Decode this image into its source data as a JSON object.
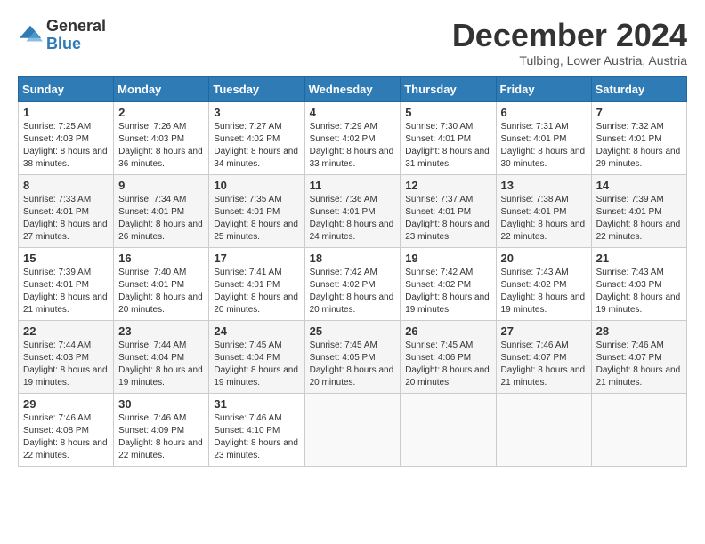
{
  "logo": {
    "general": "General",
    "blue": "Blue"
  },
  "title": "December 2024",
  "location": "Tulbing, Lower Austria, Austria",
  "weekdays": [
    "Sunday",
    "Monday",
    "Tuesday",
    "Wednesday",
    "Thursday",
    "Friday",
    "Saturday"
  ],
  "weeks": [
    [
      {
        "day": "1",
        "sunrise": "7:25 AM",
        "sunset": "4:03 PM",
        "daylight": "8 hours and 38 minutes."
      },
      {
        "day": "2",
        "sunrise": "7:26 AM",
        "sunset": "4:03 PM",
        "daylight": "8 hours and 36 minutes."
      },
      {
        "day": "3",
        "sunrise": "7:27 AM",
        "sunset": "4:02 PM",
        "daylight": "8 hours and 34 minutes."
      },
      {
        "day": "4",
        "sunrise": "7:29 AM",
        "sunset": "4:02 PM",
        "daylight": "8 hours and 33 minutes."
      },
      {
        "day": "5",
        "sunrise": "7:30 AM",
        "sunset": "4:01 PM",
        "daylight": "8 hours and 31 minutes."
      },
      {
        "day": "6",
        "sunrise": "7:31 AM",
        "sunset": "4:01 PM",
        "daylight": "8 hours and 30 minutes."
      },
      {
        "day": "7",
        "sunrise": "7:32 AM",
        "sunset": "4:01 PM",
        "daylight": "8 hours and 29 minutes."
      }
    ],
    [
      {
        "day": "8",
        "sunrise": "7:33 AM",
        "sunset": "4:01 PM",
        "daylight": "8 hours and 27 minutes."
      },
      {
        "day": "9",
        "sunrise": "7:34 AM",
        "sunset": "4:01 PM",
        "daylight": "8 hours and 26 minutes."
      },
      {
        "day": "10",
        "sunrise": "7:35 AM",
        "sunset": "4:01 PM",
        "daylight": "8 hours and 25 minutes."
      },
      {
        "day": "11",
        "sunrise": "7:36 AM",
        "sunset": "4:01 PM",
        "daylight": "8 hours and 24 minutes."
      },
      {
        "day": "12",
        "sunrise": "7:37 AM",
        "sunset": "4:01 PM",
        "daylight": "8 hours and 23 minutes."
      },
      {
        "day": "13",
        "sunrise": "7:38 AM",
        "sunset": "4:01 PM",
        "daylight": "8 hours and 22 minutes."
      },
      {
        "day": "14",
        "sunrise": "7:39 AM",
        "sunset": "4:01 PM",
        "daylight": "8 hours and 22 minutes."
      }
    ],
    [
      {
        "day": "15",
        "sunrise": "7:39 AM",
        "sunset": "4:01 PM",
        "daylight": "8 hours and 21 minutes."
      },
      {
        "day": "16",
        "sunrise": "7:40 AM",
        "sunset": "4:01 PM",
        "daylight": "8 hours and 20 minutes."
      },
      {
        "day": "17",
        "sunrise": "7:41 AM",
        "sunset": "4:01 PM",
        "daylight": "8 hours and 20 minutes."
      },
      {
        "day": "18",
        "sunrise": "7:42 AM",
        "sunset": "4:02 PM",
        "daylight": "8 hours and 20 minutes."
      },
      {
        "day": "19",
        "sunrise": "7:42 AM",
        "sunset": "4:02 PM",
        "daylight": "8 hours and 19 minutes."
      },
      {
        "day": "20",
        "sunrise": "7:43 AM",
        "sunset": "4:02 PM",
        "daylight": "8 hours and 19 minutes."
      },
      {
        "day": "21",
        "sunrise": "7:43 AM",
        "sunset": "4:03 PM",
        "daylight": "8 hours and 19 minutes."
      }
    ],
    [
      {
        "day": "22",
        "sunrise": "7:44 AM",
        "sunset": "4:03 PM",
        "daylight": "8 hours and 19 minutes."
      },
      {
        "day": "23",
        "sunrise": "7:44 AM",
        "sunset": "4:04 PM",
        "daylight": "8 hours and 19 minutes."
      },
      {
        "day": "24",
        "sunrise": "7:45 AM",
        "sunset": "4:04 PM",
        "daylight": "8 hours and 19 minutes."
      },
      {
        "day": "25",
        "sunrise": "7:45 AM",
        "sunset": "4:05 PM",
        "daylight": "8 hours and 20 minutes."
      },
      {
        "day": "26",
        "sunrise": "7:45 AM",
        "sunset": "4:06 PM",
        "daylight": "8 hours and 20 minutes."
      },
      {
        "day": "27",
        "sunrise": "7:46 AM",
        "sunset": "4:07 PM",
        "daylight": "8 hours and 21 minutes."
      },
      {
        "day": "28",
        "sunrise": "7:46 AM",
        "sunset": "4:07 PM",
        "daylight": "8 hours and 21 minutes."
      }
    ],
    [
      {
        "day": "29",
        "sunrise": "7:46 AM",
        "sunset": "4:08 PM",
        "daylight": "8 hours and 22 minutes."
      },
      {
        "day": "30",
        "sunrise": "7:46 AM",
        "sunset": "4:09 PM",
        "daylight": "8 hours and 22 minutes."
      },
      {
        "day": "31",
        "sunrise": "7:46 AM",
        "sunset": "4:10 PM",
        "daylight": "8 hours and 23 minutes."
      },
      null,
      null,
      null,
      null
    ]
  ],
  "labels": {
    "sunrise": "Sunrise:",
    "sunset": "Sunset:",
    "daylight": "Daylight:"
  }
}
